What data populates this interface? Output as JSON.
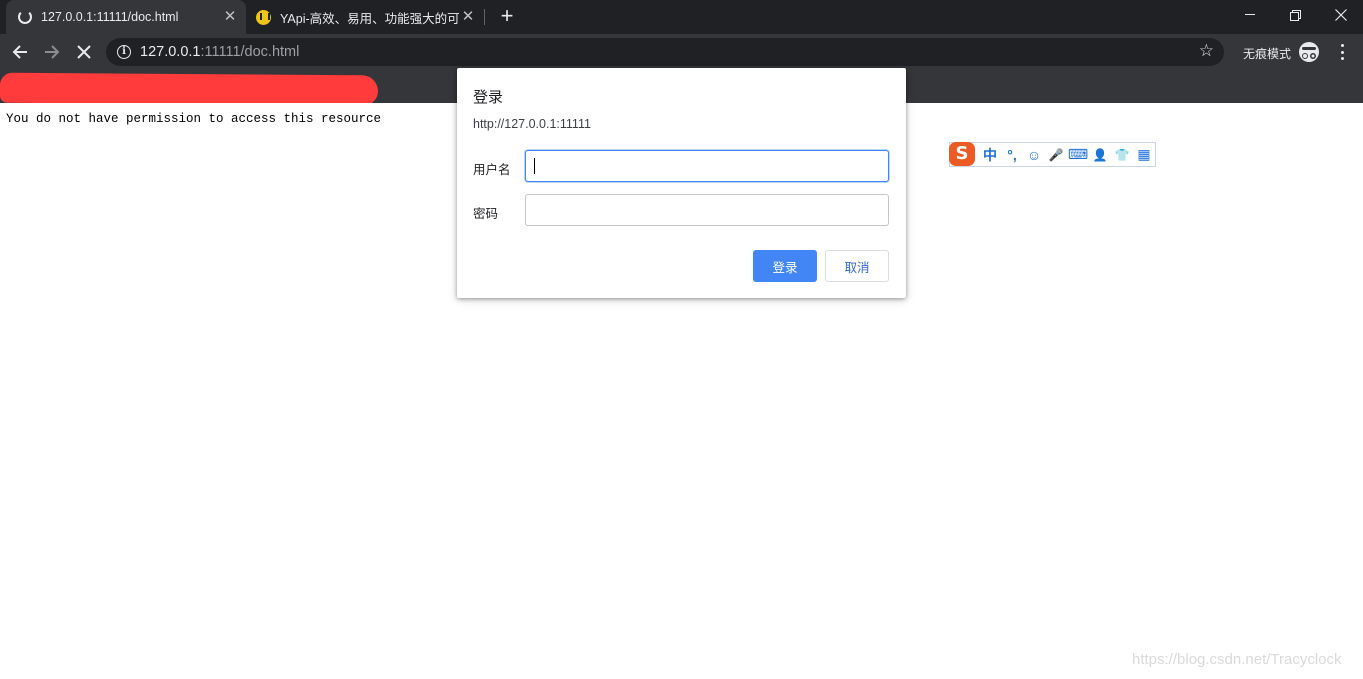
{
  "tabs": [
    {
      "title": "127.0.0.1:11111/doc.html",
      "close": "✕"
    },
    {
      "title": "YApi-高效、易用、功能强大的可",
      "close": "✕"
    }
  ],
  "new_tab": "+",
  "window_controls": {
    "minimize": "—",
    "restore": "❐",
    "close": "✕"
  },
  "toolbar": {
    "back": "←",
    "forward": "→",
    "stop": "✕",
    "info_icon": "i",
    "url_host": "127.0.0.1",
    "url_rest": ":11111/doc.html",
    "bookmark": "☆",
    "incognito_label": "无痕模式"
  },
  "page": {
    "message": "You do not have permission to access this resource",
    "watermark": "https://blog.csdn.net/Tracyclock"
  },
  "ime": {
    "logo": "S",
    "items": [
      "中",
      "°,",
      "☺",
      "🎤",
      "⌨",
      "👤",
      "👕",
      "▦"
    ]
  },
  "dialog": {
    "title": "登录",
    "origin": "http://127.0.0.1:11111",
    "username_label": "用户名",
    "username_value": "",
    "password_label": "密码",
    "password_value": "",
    "login_button": "登录",
    "cancel_button": "取消"
  },
  "colors": {
    "tab_strip": "#202124",
    "toolbar": "#35363a",
    "accent": "#4285f4",
    "redaction": "#ff3b3b",
    "ime_logo": "#ee5a24"
  }
}
